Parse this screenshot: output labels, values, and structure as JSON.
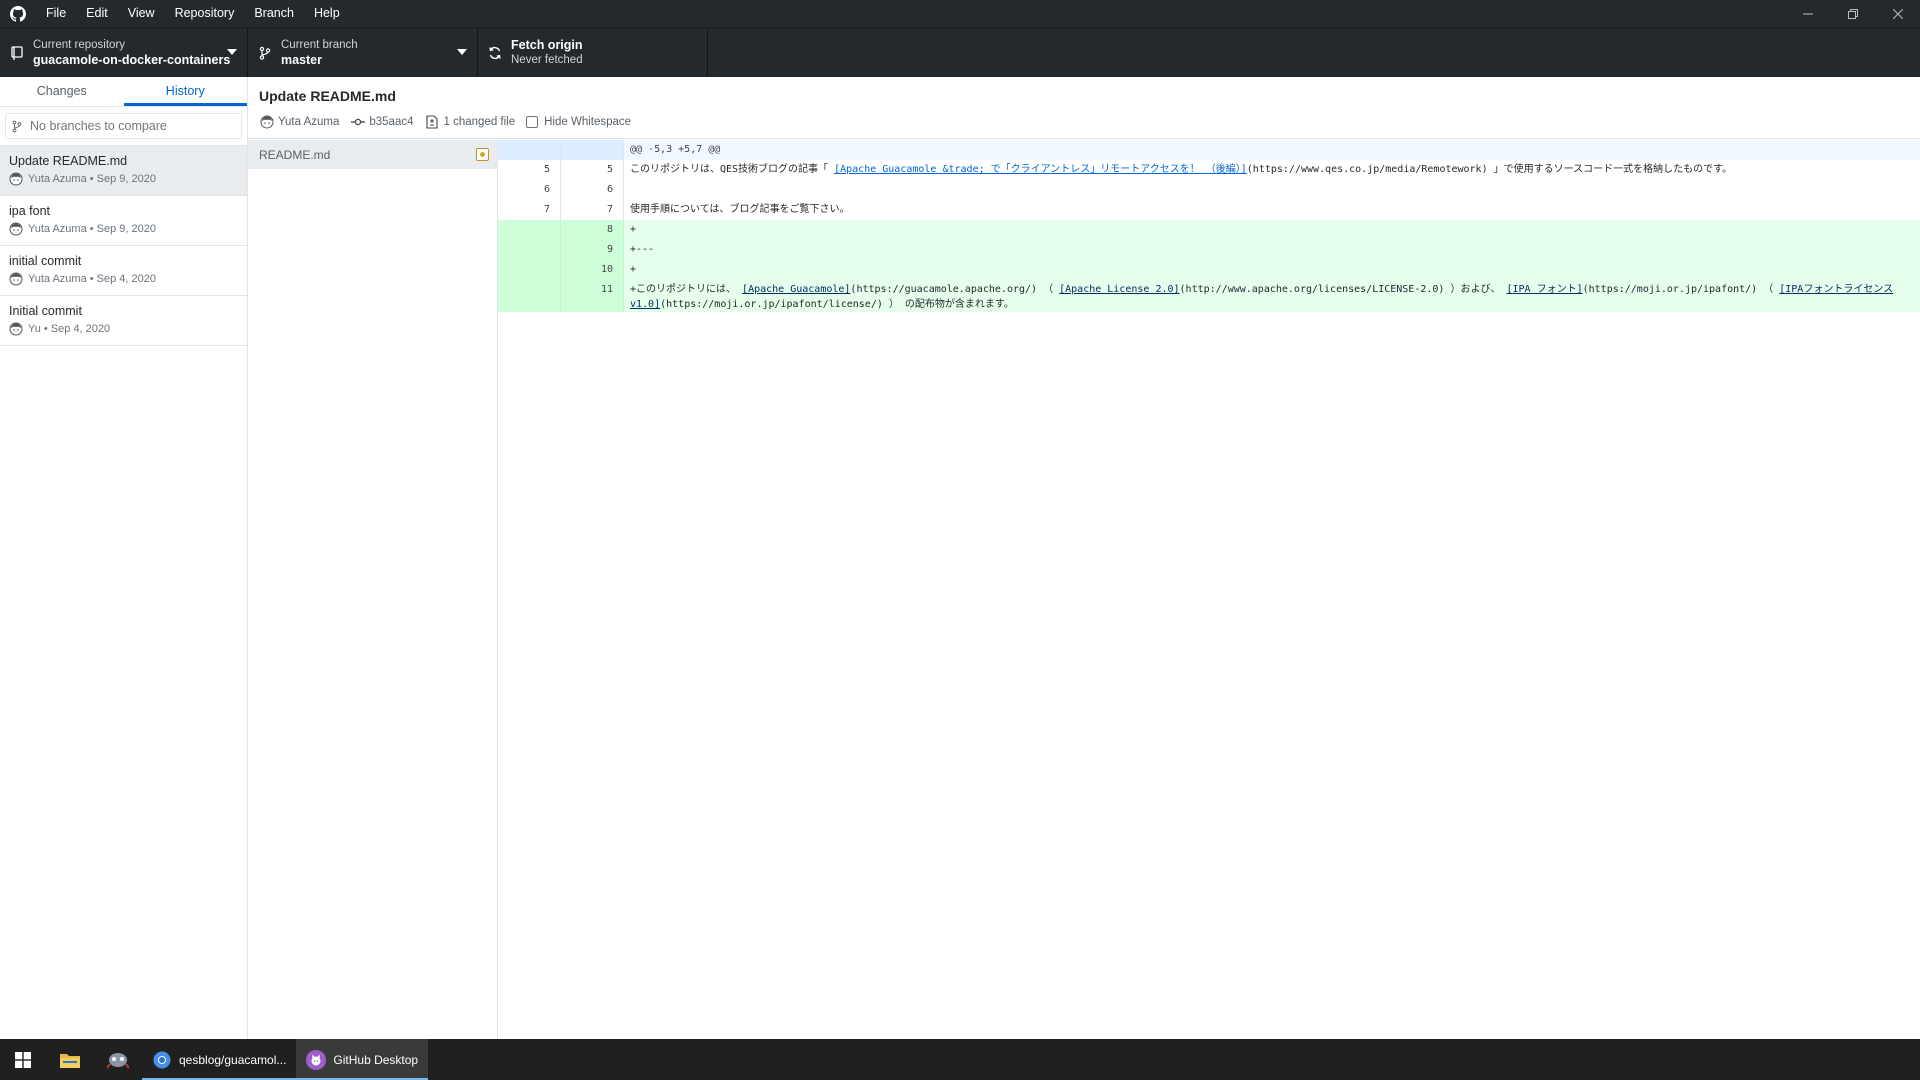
{
  "window": {
    "menu": [
      "File",
      "Edit",
      "View",
      "Repository",
      "Branch",
      "Help"
    ]
  },
  "toolbar": {
    "repo_label": "Current repository",
    "repo_value": "guacamole-on-docker-containers",
    "branch_label": "Current branch",
    "branch_value": "master",
    "fetch_label": "Fetch origin",
    "fetch_sub": "Never fetched"
  },
  "sidebar": {
    "tabs": [
      "Changes",
      "History"
    ],
    "active_tab": "History",
    "branch_filter_placeholder": "No branches to compare",
    "commits": [
      {
        "title": "Update README.md",
        "meta": "Yuta Azuma • Sep 9, 2020",
        "selected": true
      },
      {
        "title": "ipa font",
        "meta": "Yuta Azuma • Sep 9, 2020",
        "selected": false
      },
      {
        "title": "initial commit",
        "meta": "Yuta Azuma • Sep 4, 2020",
        "selected": false
      },
      {
        "title": "Initial commit",
        "meta": "Yu • Sep 4, 2020",
        "selected": false
      }
    ]
  },
  "commit": {
    "title": "Update README.md",
    "author": "Yuta Azuma",
    "sha": "b35aac4",
    "changed_files": "1 changed file",
    "hide_whitespace": "Hide Whitespace"
  },
  "files": [
    {
      "name": "README.md",
      "status": "modified"
    }
  ],
  "diff": {
    "hunk": "@@ -5,3 +5,7 @@",
    "lines": {
      "l5_old": "5",
      "l5_new": "5",
      "l5_pre": " このリポジトリは、QES技術ブログの記事「 ",
      "l5_link": "[Apache Guacamole &trade; で「クライアントレス」リモートアクセスを！ （後編）]",
      "l5_post": "(https://www.qes.co.jp/media/Remotework) 」で使用するソースコード一式を格納したものです。",
      "l6_old": "6",
      "l6_new": "6",
      "l6_text": "",
      "l7_old": "7",
      "l7_new": "7",
      "l7_text": " 使用手順については、ブログ記事をご覧下さい。",
      "l8_new": "8",
      "l8_text": "+",
      "l9_new": "9",
      "l9_text": "+---",
      "l10_new": "10",
      "l10_text": "+",
      "l11_new": "11",
      "l11_a": "+このリポジトリには、 ",
      "l11_link1": "[Apache Guacamole]",
      "l11_b": "(https://guacamole.apache.org/) （ ",
      "l11_link2": "[Apache License 2.0]",
      "l11_c": "(http://www.apache.org/licenses/LICENSE-2.0) ）および、 ",
      "l11_link3": "[IPA フォント]",
      "l11_d": "(https://moji.or.jp/ipafont/) （ ",
      "l11_link4": "[IPAフォントライセンスv1.0]",
      "l11_e": "(https://moji.or.jp/ipafont/license/) ） の配布物が含まれます。"
    }
  },
  "taskbar": {
    "chrome_label": "qesblog/guacamol...",
    "github_label": "GitHub Desktop"
  },
  "icons": {
    "app_logo": "github-logo-icon",
    "repo": "repo-icon",
    "branch": "git-branch-icon",
    "fetch": "sync-icon",
    "avatar": "avatar-icon"
  },
  "colors": {
    "chrome_dark": "#24292e",
    "accent": "#0366d6",
    "added_bg": "#e6ffed",
    "added_gutter": "#cdffd8",
    "hunk_bg": "#f1f8ff",
    "modified": "#d4a72c"
  }
}
